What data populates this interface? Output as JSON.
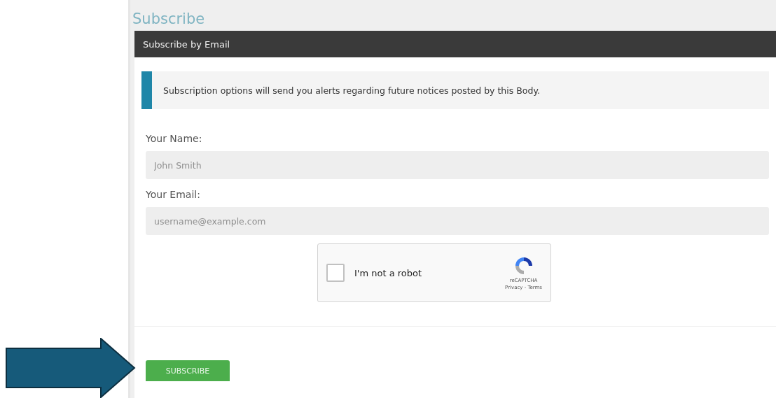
{
  "page": {
    "title": "Subscribe"
  },
  "panel": {
    "heading": "Subscribe by Email",
    "notice": "Subscription options will send you alerts regarding future notices posted by this Body.",
    "fields": [
      {
        "label": "Your Name:",
        "placeholder": "John Smith"
      },
      {
        "label": "Your Email:",
        "placeholder": "username@example.com"
      }
    ],
    "captcha": {
      "label": "I'm not a robot",
      "checked": false,
      "brand": "reCAPTCHA",
      "links": "Privacy - Terms"
    },
    "submit": "SUBSCRIBE"
  }
}
